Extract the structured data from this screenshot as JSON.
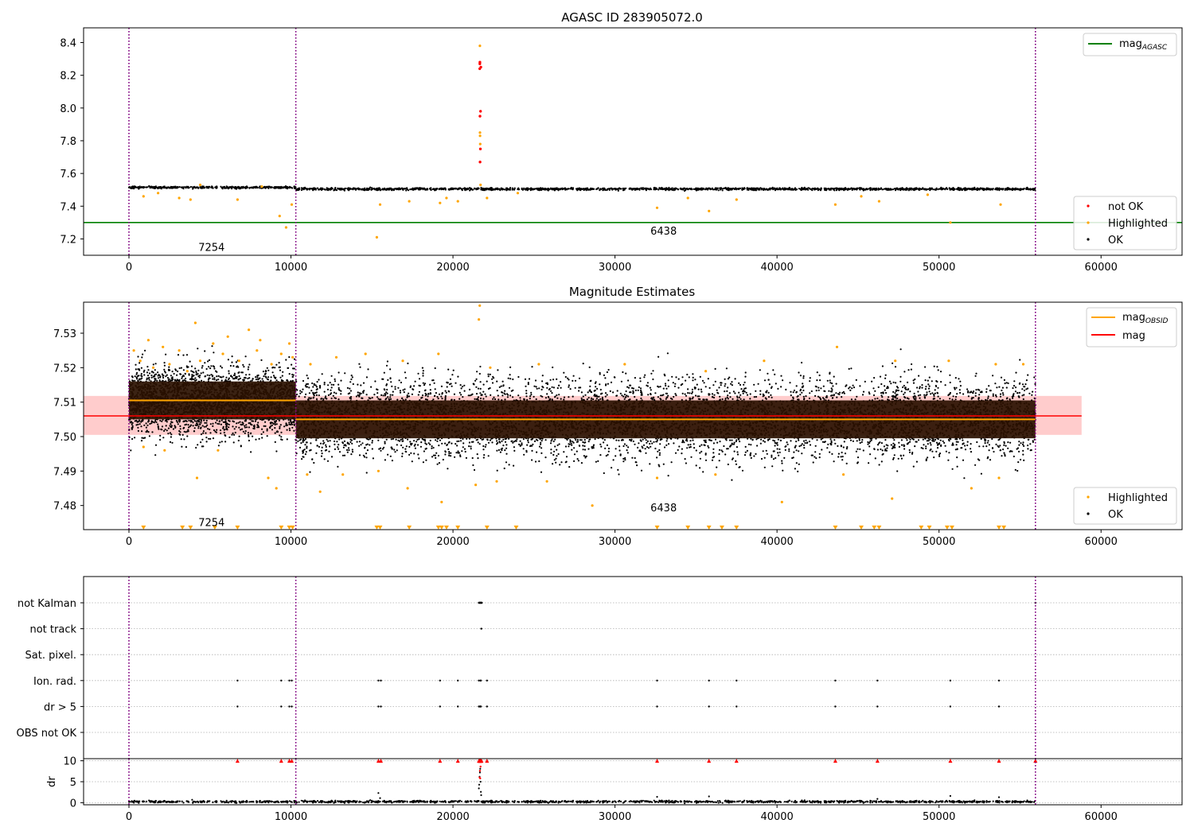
{
  "figure": {
    "title": "AGASC ID 283905072.0"
  },
  "chart_data": [
    {
      "type": "scatter",
      "title": "AGASC ID 283905072.0",
      "xlim": [
        -2800,
        65000
      ],
      "ylim": [
        7.1,
        8.49
      ],
      "xticks": [
        0,
        10000,
        20000,
        30000,
        40000,
        50000,
        60000
      ],
      "yticks": [
        7.2,
        7.4,
        7.6,
        7.8,
        8.0,
        8.2,
        8.4
      ],
      "obsid_boundaries": [
        0,
        10300,
        55950
      ],
      "obsid_labels": [
        {
          "text": "7254",
          "x": 5100,
          "y": 7.15
        },
        {
          "text": "6438",
          "x": 33000,
          "y": 7.25
        }
      ],
      "mag_agasc": 7.3,
      "ok_band": {
        "x_start": 0,
        "x_end": 55950,
        "y": 7.51
      },
      "series": [
        {
          "name": "not OK",
          "color": "#ff0000",
          "x": [
            21650,
            21655,
            21660,
            21665,
            21670,
            21690,
            21700,
            21720
          ],
          "y": [
            8.24,
            8.27,
            8.28,
            7.95,
            7.67,
            7.75,
            7.98,
            8.25
          ]
        },
        {
          "name": "Highlighted",
          "color": "#ffa500",
          "x": [
            900,
            1800,
            3100,
            3800,
            4400,
            6700,
            8200,
            9300,
            9700,
            10050,
            15300,
            15500,
            17300,
            19200,
            19600,
            20300,
            21660,
            21665,
            21670,
            21680,
            21700,
            22100,
            24000,
            32600,
            34500,
            35800,
            37500,
            43600,
            45200,
            46300,
            49300,
            50700,
            53800
          ],
          "y": [
            7.46,
            7.48,
            7.45,
            7.44,
            7.53,
            7.44,
            7.52,
            7.34,
            7.27,
            7.41,
            7.21,
            7.41,
            7.43,
            7.42,
            7.45,
            7.43,
            8.38,
            7.85,
            7.83,
            7.78,
            7.53,
            7.45,
            7.48,
            7.39,
            7.45,
            7.37,
            7.44,
            7.41,
            7.46,
            7.43,
            7.47,
            7.3,
            7.41
          ]
        },
        {
          "name": "OK",
          "color": "#000000",
          "x_range": [
            0,
            55950
          ],
          "y_center": 7.51,
          "y_spread": 0.012
        }
      ],
      "legend": {
        "position": "top-right",
        "entries": [
          "mag_AGASC"
        ]
      },
      "legend2": {
        "position": "bottom-right",
        "entries": [
          "not OK",
          "Highlighted",
          "OK"
        ]
      }
    },
    {
      "type": "scatter",
      "title": "Magnitude Estimates",
      "xlim": [
        -2800,
        65000
      ],
      "ylim": [
        7.473,
        7.539
      ],
      "xticks": [
        0,
        10000,
        20000,
        30000,
        40000,
        50000,
        60000
      ],
      "yticks": [
        7.48,
        7.49,
        7.5,
        7.51,
        7.52,
        7.53
      ],
      "obsid_boundaries": [
        0,
        10300,
        55950
      ],
      "obsid_labels": [
        {
          "text": "7254",
          "x": 5100,
          "y": 7.4752
        },
        {
          "text": "6438",
          "x": 33000,
          "y": 7.4795
        }
      ],
      "mag": 7.506,
      "mag_band": [
        7.5005,
        7.5118
      ],
      "mag_band_xlim": [
        -2800,
        58800
      ],
      "obsid_segments": [
        {
          "obsid": "7254",
          "x_start": 0,
          "x_end": 10300,
          "mag_obsid": 7.5105,
          "band": [
            7.505,
            7.516
          ]
        },
        {
          "obsid": "6438",
          "x_start": 10300,
          "x_end": 55950,
          "mag_obsid": 7.505,
          "band": [
            7.4995,
            7.5105
          ]
        }
      ],
      "series": [
        {
          "name": "Highlighted",
          "color": "#ffa500",
          "x": [
            300,
            700,
            1200,
            1500,
            2100,
            2500,
            3100,
            3600,
            4100,
            4400,
            5200,
            5800,
            6100,
            6800,
            7400,
            7900,
            8100,
            8800,
            9400,
            9900,
            10100,
            11200,
            12800,
            14600,
            16900,
            19100,
            21600,
            21650,
            22300,
            25300,
            30600,
            35600,
            39200,
            43700,
            47300,
            50600,
            53500,
            55200
          ],
          "y": [
            7.525,
            7.522,
            7.528,
            7.52,
            7.526,
            7.521,
            7.525,
            7.519,
            7.533,
            7.522,
            7.527,
            7.524,
            7.529,
            7.522,
            7.531,
            7.525,
            7.528,
            7.521,
            7.524,
            7.527,
            7.523,
            7.521,
            7.523,
            7.524,
            7.522,
            7.524,
            7.534,
            7.538,
            7.52,
            7.521,
            7.521,
            7.519,
            7.522,
            7.526,
            7.522,
            7.522,
            7.521,
            7.521
          ]
        },
        {
          "name": "Highlighted (low)",
          "color": "#ffa500",
          "x": [
            900,
            2200,
            4200,
            5500,
            8600,
            9100,
            11000,
            11800,
            13200,
            15400,
            17200,
            19300,
            21400,
            22700,
            25800,
            28600,
            32600,
            36200,
            40300,
            44100,
            47100,
            52000,
            53700
          ],
          "y": [
            7.497,
            7.496,
            7.488,
            7.496,
            7.488,
            7.485,
            7.489,
            7.484,
            7.489,
            7.49,
            7.485,
            7.481,
            7.486,
            7.487,
            7.487,
            7.48,
            7.488,
            7.489,
            7.481,
            7.489,
            7.482,
            7.485,
            7.488
          ]
        },
        {
          "name": "Highlighted (clipped)",
          "color": "#ffa500",
          "marker": "triangle-down",
          "y": 7.4735,
          "x": [
            900,
            3300,
            3800,
            5300,
            6700,
            9400,
            9900,
            10100,
            15300,
            15500,
            17300,
            19100,
            19300,
            19600,
            20300,
            22100,
            23900,
            32600,
            34500,
            35800,
            36600,
            37500,
            43600,
            45200,
            46000,
            46300,
            48900,
            49400,
            50500,
            50800,
            53700,
            54000
          ]
        },
        {
          "name": "OK",
          "color": "#000000",
          "x_range": [
            0,
            55950
          ],
          "y_center": 7.507,
          "y_spread": 0.0085
        }
      ],
      "legend": {
        "position": "top-right",
        "entries": [
          "mag_OBSID",
          "mag"
        ]
      },
      "legend2": {
        "position": "bottom-right",
        "entries": [
          "Highlighted",
          "OK"
        ]
      }
    },
    {
      "type": "scatter",
      "title": "",
      "xlim": [
        -2800,
        65000
      ],
      "xticks": [
        0,
        10000,
        20000,
        30000,
        40000,
        50000,
        60000
      ],
      "flags": [
        "not Kalman",
        "not track",
        "Sat. pixel.",
        "Ion. rad.",
        "dr > 5",
        "OBS not OK"
      ],
      "flag_events": {
        "not Kalman": [
          21600,
          21620,
          21640,
          21660,
          21680,
          21700,
          21720,
          21740,
          21760,
          21780,
          55950
        ],
        "not track": [
          21750
        ],
        "Sat. pixel.": [],
        "Ion. rad.": [
          6700,
          9400,
          9900,
          10050,
          15400,
          15550,
          19200,
          20300,
          21600,
          21700,
          21720,
          22100,
          32600,
          35800,
          37500,
          43600,
          46200,
          50700,
          53700
        ],
        "dr > 5": [
          6700,
          9400,
          9900,
          10050,
          15400,
          15550,
          19200,
          20300,
          21600,
          21660,
          21700,
          21720,
          22100,
          32600,
          35800,
          37500,
          43600,
          46200,
          50700,
          53700
        ],
        "OBS not OK": []
      },
      "dr": {
        "ylabel": "dr",
        "ylim": [
          -0.5,
          10.5
        ],
        "yticks": [
          0,
          5,
          10
        ],
        "clip": 10,
        "clipped_x": [
          6700,
          9400,
          9900,
          10050,
          15400,
          15550,
          19200,
          20300,
          21600,
          21640,
          21660,
          21680,
          21700,
          21720,
          21760,
          22100,
          32600,
          35800,
          37500,
          43600,
          46200,
          50700,
          53700,
          55950
        ],
        "outliers": [
          {
            "x": 15400,
            "y": 2.3
          },
          {
            "x": 15500,
            "y": 1.1
          },
          {
            "x": 21600,
            "y": 3.4
          },
          {
            "x": 21620,
            "y": 4.3
          },
          {
            "x": 21640,
            "y": 6.2
          },
          {
            "x": 21660,
            "y": 7.2
          },
          {
            "x": 21680,
            "y": 8.1
          },
          {
            "x": 21700,
            "y": 5.0
          },
          {
            "x": 21720,
            "y": 2.6
          },
          {
            "x": 21740,
            "y": 1.8
          },
          {
            "x": 32600,
            "y": 1.4
          },
          {
            "x": 35800,
            "y": 1.5
          },
          {
            "x": 50700,
            "y": 1.6
          },
          {
            "x": 53700,
            "y": 1.3
          },
          {
            "x": 46200,
            "y": 0.9
          },
          {
            "x": 3900,
            "y": 0.7
          }
        ]
      }
    }
  ],
  "colors": {
    "ok": "#000000",
    "highlighted": "#ffa500",
    "not_ok": "#ff0000",
    "mag_agasc": "#008000",
    "mag": "#ff0000",
    "mag_obsid": "#ffa500",
    "obsid_boundary": "#800080",
    "mag_band": "#ffcccc",
    "obsid_band": "#2a1000"
  }
}
